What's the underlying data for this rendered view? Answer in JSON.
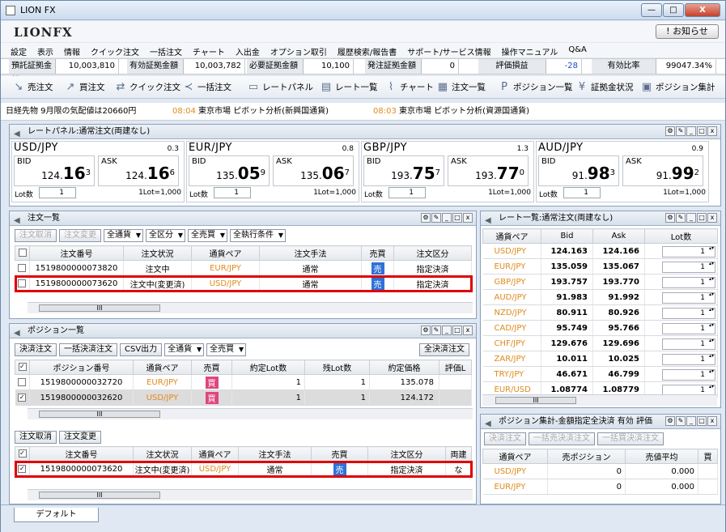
{
  "window": {
    "title": "LION FX",
    "min": "—",
    "max": "□",
    "close": "X"
  },
  "brand": {
    "logo": "LIONFX",
    "notice": "! お知らせ"
  },
  "menu": [
    "設定",
    "表示",
    "情報",
    "クイック注文",
    "一括注文",
    "チャート",
    "入出金",
    "オプション取引",
    "履歴検索/報告書",
    "サポート/サービス情報",
    "操作マニュアル",
    "Q&A"
  ],
  "margin": {
    "l1": "預託証拠金額",
    "v1": "10,003,810",
    "l2": "有効証拠金額",
    "v2": "10,003,782",
    "l3": "必要証拠金額",
    "v3": "10,100",
    "l4": "発注証拠金額",
    "v4": "0",
    "l5": "評価損益",
    "v5": "-28",
    "l6": "有効比率",
    "v6": "99047.34%"
  },
  "toolbar": [
    "売注文",
    "買注文",
    "クイック注文",
    "一括注文",
    "レートパネル",
    "レート一覧",
    "チャート",
    "注文一覧",
    "ポジション一覧",
    "証拠金状況",
    "ポジション集計"
  ],
  "ticker": {
    "t1": "日経先物 9月限の気配値は20660円",
    "time1": "08:04",
    "t2": "東京市場 ピボット分析(新興国通貨)",
    "time2": "08:03",
    "t3": "東京市場 ピボット分析(資源国通貨)"
  },
  "ratepanel": {
    "title": "レートパネル:通常注文(両建なし)",
    "bid": "BID",
    "ask": "ASK",
    "lot": "Lot数",
    "lotval": "1",
    "lotunit": "1Lot=1,000",
    "cards": [
      {
        "pair": "USD/JPY",
        "spread": "0.3",
        "bidA": "124.",
        "bidB": "16",
        "bidC": "3",
        "askA": "124.",
        "askB": "16",
        "askC": "6"
      },
      {
        "pair": "EUR/JPY",
        "spread": "0.8",
        "bidA": "135.",
        "bidB": "05",
        "bidC": "9",
        "askA": "135.",
        "askB": "06",
        "askC": "7"
      },
      {
        "pair": "GBP/JPY",
        "spread": "1.3",
        "bidA": "193.",
        "bidB": "75",
        "bidC": "7",
        "askA": "193.",
        "askB": "77",
        "askC": "0"
      },
      {
        "pair": "AUD/JPY",
        "spread": "0.9",
        "bidA": "91.",
        "bidB": "98",
        "bidC": "3",
        "askA": "91.",
        "askB": "99",
        "askC": "2"
      }
    ]
  },
  "orders": {
    "title": "注文一覧",
    "btn1": "注文取消",
    "btn2": "注文変更",
    "dd1": "全通貨",
    "dd2": "全区分",
    "dd3": "全売買",
    "dd4": "全執行条件",
    "headers": [
      "",
      "注文番号",
      "注文状況",
      "通貨ペア",
      "注文手法",
      "売買",
      "注文区分"
    ],
    "rows": [
      {
        "no": "1519800000073820",
        "status": "注文中",
        "pair": "EUR/JPY",
        "method": "通常",
        "side": "売",
        "kind": "指定決済"
      },
      {
        "no": "1519800000073620",
        "status": "注文中(変更済)",
        "pair": "USD/JPY",
        "method": "通常",
        "side": "売",
        "kind": "指定決済"
      }
    ]
  },
  "positions": {
    "title": "ポジション一覧",
    "btn1": "決済注文",
    "btn2": "一括決済注文",
    "btn3": "CSV出力",
    "dd1": "全通貨",
    "dd2": "全売買",
    "btn4": "全決済注文",
    "headers": [
      "",
      "ポジション番号",
      "通貨ペア",
      "売買",
      "約定Lot数",
      "残Lot数",
      "約定価格",
      "評価L"
    ],
    "rows": [
      {
        "no": "1519800000032720",
        "pair": "EUR/JPY",
        "side": "買",
        "lot": "1",
        "rem": "1",
        "price": "135.078"
      },
      {
        "no": "1519800000032620",
        "pair": "USD/JPY",
        "side": "買",
        "lot": "1",
        "rem": "1",
        "price": "124.172"
      }
    ],
    "sub": {
      "btn1": "注文取消",
      "btn2": "注文変更",
      "headers": [
        "",
        "注文番号",
        "注文状況",
        "通貨ペア",
        "注文手法",
        "売買",
        "注文区分",
        "両建"
      ],
      "row": {
        "no": "1519800000073620",
        "status": "注文中(変更済)",
        "pair": "USD/JPY",
        "method": "通常",
        "side": "売",
        "kind": "指定決済",
        "extra": "な"
      }
    }
  },
  "ratelist": {
    "title": "レート一覧:通常注文(両建なし)",
    "headers": [
      "通貨ペア",
      "Bid",
      "Ask",
      "Lot数"
    ],
    "rows": [
      {
        "p": "USD/JPY",
        "b": "124.163",
        "a": "124.166",
        "l": "1"
      },
      {
        "p": "EUR/JPY",
        "b": "135.059",
        "a": "135.067",
        "l": "1"
      },
      {
        "p": "GBP/JPY",
        "b": "193.757",
        "a": "193.770",
        "l": "1"
      },
      {
        "p": "AUD/JPY",
        "b": "91.983",
        "a": "91.992",
        "l": "1"
      },
      {
        "p": "NZD/JPY",
        "b": "80.911",
        "a": "80.926",
        "l": "1"
      },
      {
        "p": "CAD/JPY",
        "b": "95.749",
        "a": "95.766",
        "l": "1"
      },
      {
        "p": "CHF/JPY",
        "b": "129.676",
        "a": "129.696",
        "l": "1"
      },
      {
        "p": "ZAR/JPY",
        "b": "10.011",
        "a": "10.025",
        "l": "1"
      },
      {
        "p": "TRY/JPY",
        "b": "46.671",
        "a": "46.799",
        "l": "1"
      },
      {
        "p": "EUR/USD",
        "b": "1.08774",
        "a": "1.08779",
        "l": "1"
      }
    ]
  },
  "summary": {
    "title": "ポジション集計-金額指定全決済 有効 評価",
    "btn1": "決済注文",
    "btn2": "一括売決済注文",
    "btn3": "一括買決済注文",
    "headers": [
      "通貨ペア",
      "売ポジション",
      "売値平均",
      "買"
    ],
    "rows": [
      {
        "p": "USD/JPY",
        "s": "0",
        "avg": "0.000"
      },
      {
        "p": "EUR/JPY",
        "s": "0",
        "avg": "0.000"
      }
    ]
  },
  "tabs": {
    "default": "デフォルト"
  },
  "scroll": {
    "thumb": "III"
  }
}
